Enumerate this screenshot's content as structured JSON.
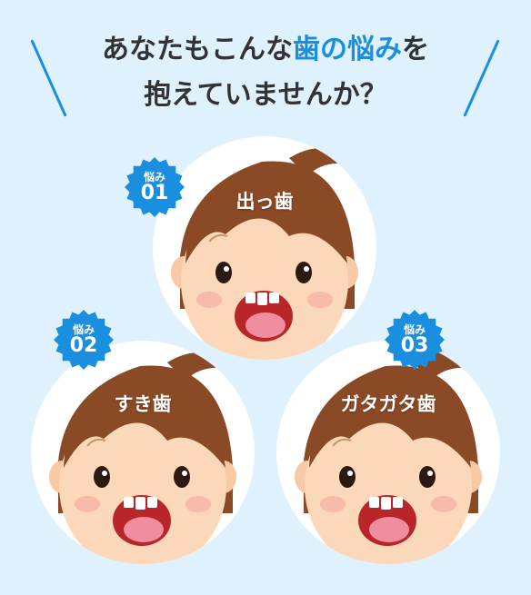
{
  "heading": {
    "line1_pre": "あなたもこんな",
    "line1_accent": "歯の悩み",
    "line1_post": "を",
    "line2": "抱えていませんか？"
  },
  "colors": {
    "accent": "#1a8fe0",
    "text": "#333333",
    "background": "#dff1fc",
    "hair": "#8a4a25"
  },
  "concerns": [
    {
      "badge_label": "悩み",
      "badge_number": "01",
      "title": "出っ歯"
    },
    {
      "badge_label": "悩み",
      "badge_number": "02",
      "title": "すき歯"
    },
    {
      "badge_label": "悩み",
      "badge_number": "03",
      "title": "ガタガタ歯"
    }
  ]
}
